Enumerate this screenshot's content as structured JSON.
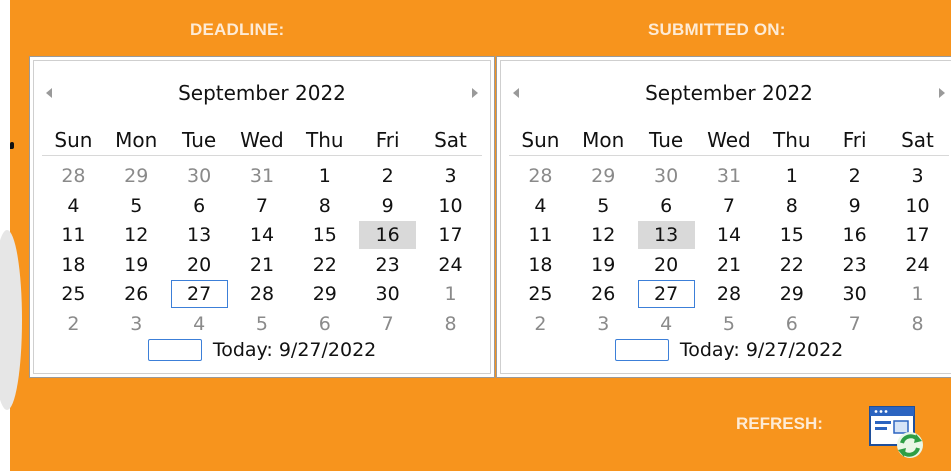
{
  "deadline": {
    "label": "DEADLINE:",
    "month_title": "September 2022",
    "days_of_week": [
      "Sun",
      "Mon",
      "Tue",
      "Wed",
      "Thu",
      "Fri",
      "Sat"
    ],
    "weeks": [
      [
        "28",
        "29",
        "30",
        "31",
        "1",
        "2",
        "3"
      ],
      [
        "4",
        "5",
        "6",
        "7",
        "8",
        "9",
        "10"
      ],
      [
        "11",
        "12",
        "13",
        "14",
        "15",
        "16",
        "17"
      ],
      [
        "18",
        "19",
        "20",
        "21",
        "22",
        "23",
        "24"
      ],
      [
        "25",
        "26",
        "27",
        "28",
        "29",
        "30",
        "1"
      ],
      [
        "2",
        "3",
        "4",
        "5",
        "6",
        "7",
        "8"
      ]
    ],
    "selected_day": "16",
    "today_day": "27",
    "today_label": "Today: 9/27/2022"
  },
  "submitted": {
    "label": "SUBMITTED ON:",
    "month_title": "September 2022",
    "days_of_week": [
      "Sun",
      "Mon",
      "Tue",
      "Wed",
      "Thu",
      "Fri",
      "Sat"
    ],
    "weeks": [
      [
        "28",
        "29",
        "30",
        "31",
        "1",
        "2",
        "3"
      ],
      [
        "4",
        "5",
        "6",
        "7",
        "8",
        "9",
        "10"
      ],
      [
        "11",
        "12",
        "13",
        "14",
        "15",
        "16",
        "17"
      ],
      [
        "18",
        "19",
        "20",
        "21",
        "22",
        "23",
        "24"
      ],
      [
        "25",
        "26",
        "27",
        "28",
        "29",
        "30",
        "1"
      ],
      [
        "2",
        "3",
        "4",
        "5",
        "6",
        "7",
        "8"
      ]
    ],
    "selected_day": "13",
    "today_day": "27",
    "today_label": "Today: 9/27/2022"
  },
  "refresh": {
    "label": "REFRESH:",
    "icon": "refresh-window-icon"
  },
  "colors": {
    "background": "#f7941d",
    "label_text": "#fdebd6",
    "selection": "#d9d9d9",
    "today_outline": "#3c7fd8"
  }
}
